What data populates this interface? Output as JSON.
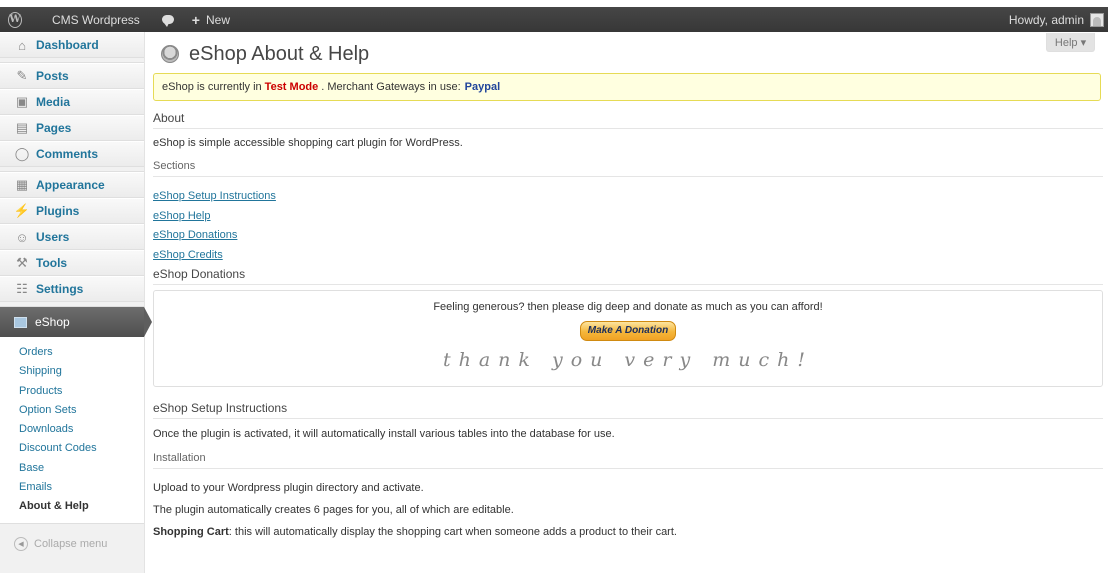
{
  "adminbar": {
    "site_name": "CMS Wordpress",
    "new_label": "New",
    "howdy": "Howdy, admin"
  },
  "sidebar": {
    "items": [
      {
        "label": "Dashboard",
        "icon": "home-icon"
      },
      {
        "label": "Posts",
        "icon": "pin-icon"
      },
      {
        "label": "Media",
        "icon": "media-icon"
      },
      {
        "label": "Pages",
        "icon": "pages-icon"
      },
      {
        "label": "Comments",
        "icon": "comment-icon"
      },
      {
        "label": "Appearance",
        "icon": "appearance-icon"
      },
      {
        "label": "Plugins",
        "icon": "plugin-icon"
      },
      {
        "label": "Users",
        "icon": "users-icon"
      },
      {
        "label": "Tools",
        "icon": "tools-icon"
      },
      {
        "label": "Settings",
        "icon": "settings-icon"
      }
    ],
    "current": "eShop",
    "submenu": [
      "Orders",
      "Shipping",
      "Products",
      "Option Sets",
      "Downloads",
      "Discount Codes",
      "Base",
      "Emails",
      "About & Help"
    ],
    "collapse": "Collapse menu"
  },
  "main": {
    "help_tab": "Help ▾",
    "title": "eShop About & Help",
    "notice": {
      "prefix": "eShop is currently in",
      "mode": "Test Mode",
      "middle": ". Merchant Gateways in use:",
      "gateway": "Paypal"
    },
    "about_heading": "About",
    "about_text": "eShop is simple accessible shopping cart plugin for WordPress.",
    "sections_heading": "Sections",
    "section_links": [
      "eShop Setup Instructions",
      "eShop Help",
      "eShop Donations",
      "eShop Credits"
    ],
    "donations_heading": "eShop Donations",
    "donate_text": "Feeling generous? then please dig deep and donate as much as you can afford!",
    "donate_button": "Make A Donation",
    "thanks": "thank you very much!",
    "setup_heading": "eShop Setup Instructions",
    "setup_text": "Once the plugin is activated, it will automatically install various tables into the database for use.",
    "installation_heading": "Installation",
    "install_p1": "Upload to your Wordpress plugin directory and activate.",
    "install_p2": "The plugin automatically creates 6 pages for you, all of which are editable.",
    "install_p3_bold": "Shopping Cart",
    "install_p3": ": this will automatically display the shopping cart when someone adds a product to their cart."
  }
}
